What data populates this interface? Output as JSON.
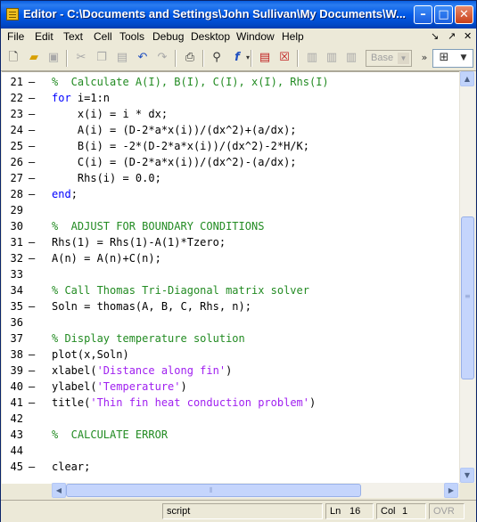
{
  "window": {
    "title": "Editor - C:\\Documents and Settings\\John Sullivan\\My Documents\\W...",
    "controls": [
      "minimize",
      "maximize",
      "close"
    ]
  },
  "menu": {
    "items": [
      "File",
      "Edit",
      "Text",
      "Cell",
      "Tools",
      "Debug",
      "Desktop",
      "Window",
      "Help"
    ],
    "right": [
      "↘",
      "↗",
      "✕"
    ]
  },
  "toolbar": {
    "base_label": "Base",
    "icons": [
      "new-file-icon",
      "open-folder-icon",
      "save-icon",
      "cut-icon",
      "copy-icon",
      "paste-icon",
      "undo-icon",
      "redo-icon",
      "print-icon",
      "find-icon",
      "function-icon",
      "breakpoint-icon",
      "clear-breakpoint-icon",
      "step-icon",
      "step-in-icon",
      "step-out-icon",
      "dock-icon"
    ]
  },
  "editor": {
    "lines": [
      {
        "n": "21",
        "dash": "–",
        "segments": [
          {
            "t": "%  Calculate A(I), B(I), C(I), x(I), Rhs(I)",
            "c": "cm"
          }
        ]
      },
      {
        "n": "22",
        "dash": "–",
        "segments": [
          {
            "t": "for",
            "c": "kw"
          },
          {
            "t": " i=1:n",
            "c": ""
          }
        ]
      },
      {
        "n": "23",
        "dash": "–",
        "segments": [
          {
            "t": "    x(i) = i * dx;",
            "c": ""
          }
        ]
      },
      {
        "n": "24",
        "dash": "–",
        "segments": [
          {
            "t": "    A(i) = (D-2*a*x(i))/(dx^2)+(a/dx);",
            "c": ""
          }
        ]
      },
      {
        "n": "25",
        "dash": "–",
        "segments": [
          {
            "t": "    B(i) = -2*(D-2*a*x(i))/(dx^2)-2*H/K;",
            "c": ""
          }
        ]
      },
      {
        "n": "26",
        "dash": "–",
        "segments": [
          {
            "t": "    C(i) = (D-2*a*x(i))/(dx^2)-(a/dx);",
            "c": ""
          }
        ]
      },
      {
        "n": "27",
        "dash": "–",
        "segments": [
          {
            "t": "    Rhs(i) = 0.0;",
            "c": ""
          }
        ]
      },
      {
        "n": "28",
        "dash": "–",
        "segments": [
          {
            "t": "end",
            "c": "kw"
          },
          {
            "t": ";",
            "c": ""
          }
        ]
      },
      {
        "n": "29",
        "dash": "",
        "segments": []
      },
      {
        "n": "30",
        "dash": "",
        "segments": [
          {
            "t": "%  ADJUST FOR BOUNDARY CONDITIONS",
            "c": "cm"
          }
        ]
      },
      {
        "n": "31",
        "dash": "–",
        "segments": [
          {
            "t": "Rhs(1) = Rhs(1)-A(1)*Tzero;",
            "c": ""
          }
        ]
      },
      {
        "n": "32",
        "dash": "–",
        "segments": [
          {
            "t": "A(n) = A(n)+C(n);",
            "c": ""
          }
        ]
      },
      {
        "n": "33",
        "dash": "",
        "segments": []
      },
      {
        "n": "34",
        "dash": "",
        "segments": [
          {
            "t": "% Call Thomas Tri-Diagonal matrix solver",
            "c": "cm"
          }
        ]
      },
      {
        "n": "35",
        "dash": "–",
        "segments": [
          {
            "t": "Soln = thomas(A, B, C, Rhs, n);",
            "c": ""
          }
        ]
      },
      {
        "n": "36",
        "dash": "",
        "segments": []
      },
      {
        "n": "37",
        "dash": "",
        "segments": [
          {
            "t": "% Display temperature solution",
            "c": "cm"
          }
        ]
      },
      {
        "n": "38",
        "dash": "–",
        "segments": [
          {
            "t": "plot(x,Soln)",
            "c": ""
          }
        ]
      },
      {
        "n": "39",
        "dash": "–",
        "segments": [
          {
            "t": "xlabel(",
            "c": ""
          },
          {
            "t": "'Distance along fin'",
            "c": "st"
          },
          {
            "t": ")",
            "c": ""
          }
        ]
      },
      {
        "n": "40",
        "dash": "–",
        "segments": [
          {
            "t": "ylabel(",
            "c": ""
          },
          {
            "t": "'Temperature'",
            "c": "st"
          },
          {
            "t": ")",
            "c": ""
          }
        ]
      },
      {
        "n": "41",
        "dash": "–",
        "segments": [
          {
            "t": "title(",
            "c": ""
          },
          {
            "t": "'Thin fin heat conduction problem'",
            "c": "st"
          },
          {
            "t": ")",
            "c": ""
          }
        ]
      },
      {
        "n": "42",
        "dash": "",
        "segments": []
      },
      {
        "n": "43",
        "dash": "",
        "segments": [
          {
            "t": "%  CALCULATE ERROR",
            "c": "cm"
          }
        ]
      },
      {
        "n": "44",
        "dash": "",
        "segments": []
      },
      {
        "n": "45",
        "dash": "–",
        "segments": [
          {
            "t": "clear;",
            "c": ""
          }
        ]
      }
    ]
  },
  "status": {
    "mode": "script",
    "ln_label": "Ln",
    "ln_value": "16",
    "col_label": "Col",
    "col_value": "1",
    "ovr": "OVR"
  }
}
